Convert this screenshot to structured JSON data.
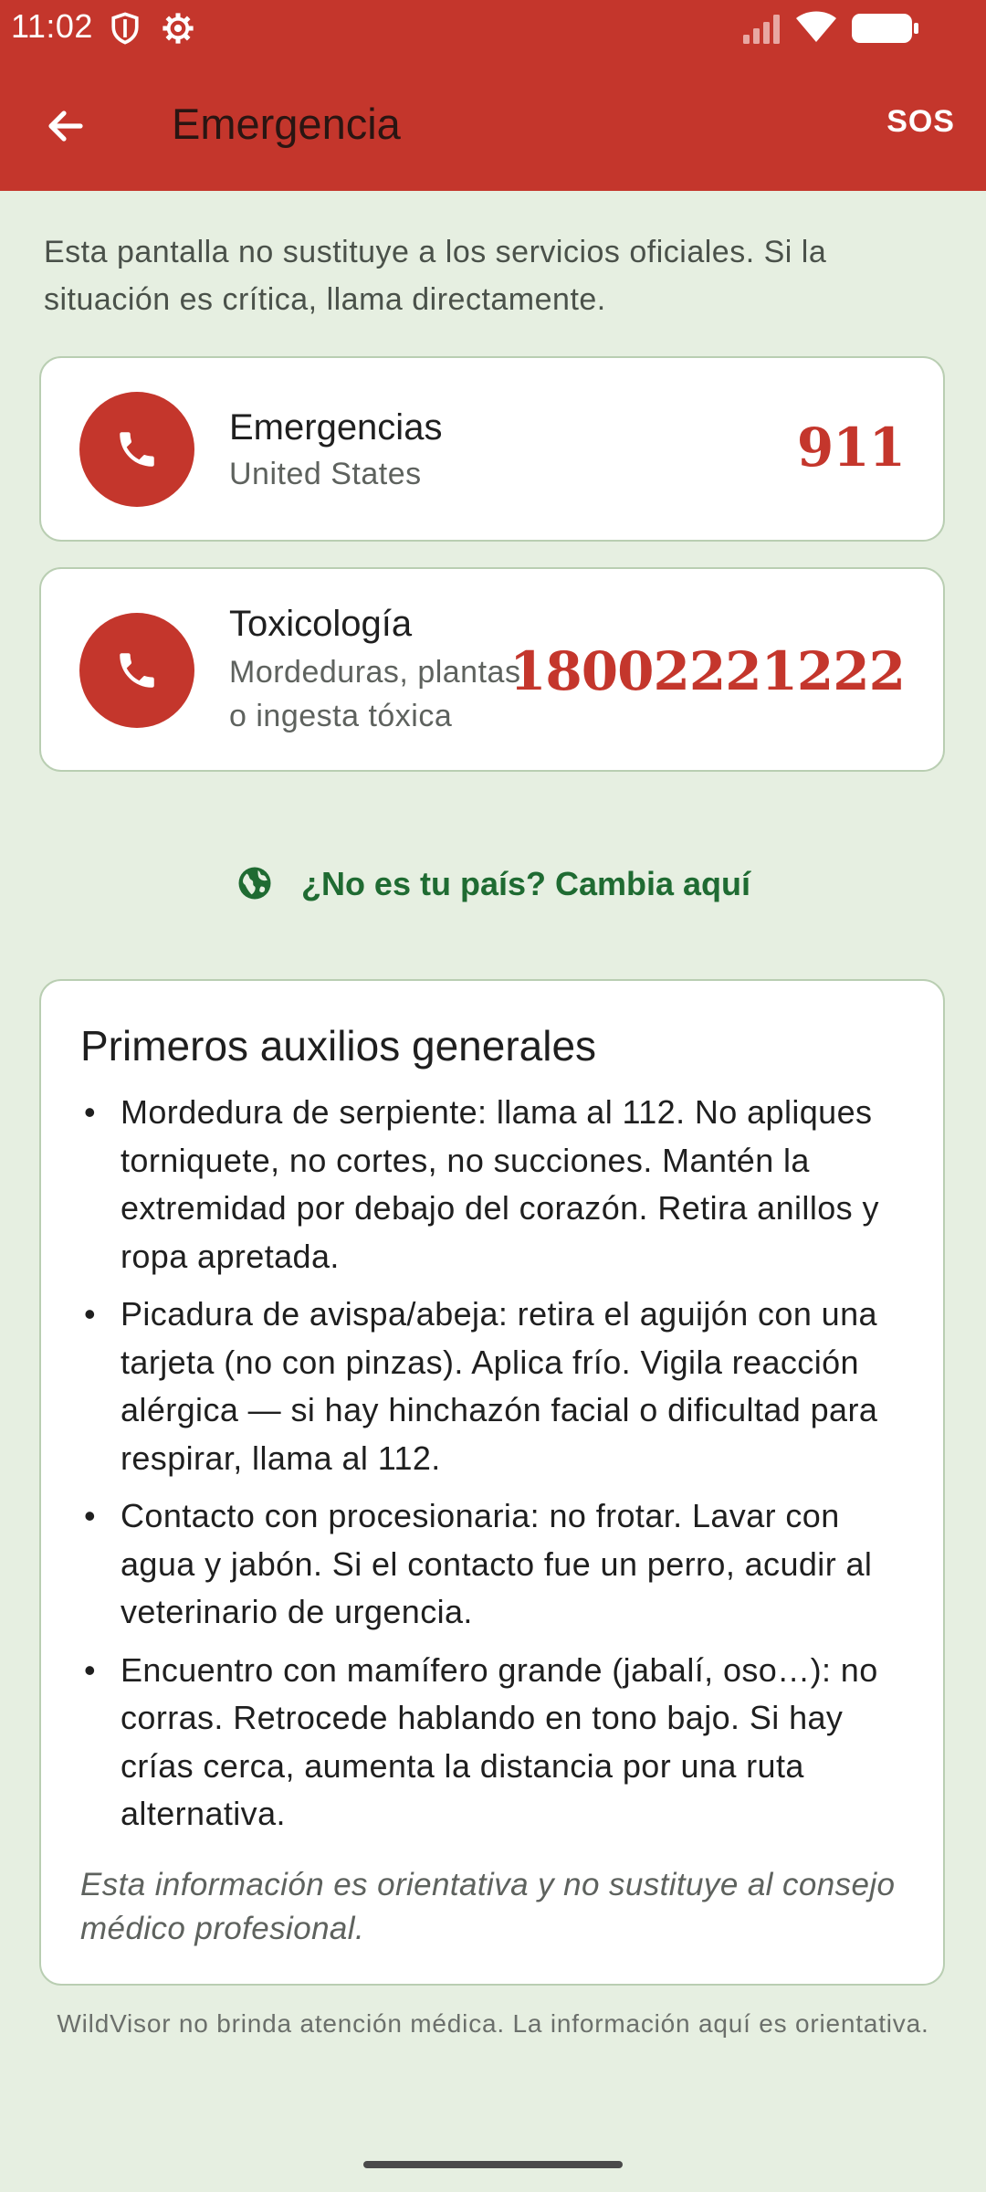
{
  "status_bar": {
    "time": "11:02"
  },
  "app_bar": {
    "title": "Emergencia",
    "sos_label": "SOS",
    "back_icon": "arrow-left-icon"
  },
  "notice": "Esta pantalla no sustituye a los servicios oficiales. Si la situación es crítica, llama directamente.",
  "contacts": [
    {
      "title": "Emergencias",
      "subtitle": "United States",
      "number": "911",
      "icon": "phone-icon"
    },
    {
      "title": "Toxicología",
      "subtitle_line1": "Mordeduras, plantas",
      "subtitle_line2": "o ingesta tóxica",
      "number": "18002221222",
      "icon": "phone-icon"
    }
  ],
  "change_country": {
    "label": "¿No es tu país? Cambia aquí",
    "icon": "globe-icon"
  },
  "first_aid": {
    "title": "Primeros auxilios generales",
    "items": [
      "Mordedura de serpiente: llama al 112. No apliques torniquete, no cortes, no succiones. Mantén la extremidad por debajo del corazón. Retira anillos y ropa apretada.",
      "Picadura de avispa/abeja: retira el aguijón con una tarjeta (no con pinzas). Aplica frío. Vigila reacción alérgica — si hay hinchazón facial o dificultad para respirar, llama al 112.",
      "Contacto con procesionaria: no frotar. Lavar con agua y jabón. Si el contacto fue un perro, acudir al veterinario de urgencia.",
      "Encuentro con mamífero grande (jabalí, oso…): no corras. Retrocede hablando en tono bajo. Si hay crías cerca, aumenta la distancia por una ruta alternativa."
    ],
    "note": "Esta información es orientativa y no sustituye al consejo médico profesional."
  },
  "disclaimer": "WildVisor no brinda atención médica. La información aquí es orientativa.",
  "colors": {
    "primary": "#c4362c",
    "background": "#e6efe1",
    "link": "#1f6b32"
  }
}
